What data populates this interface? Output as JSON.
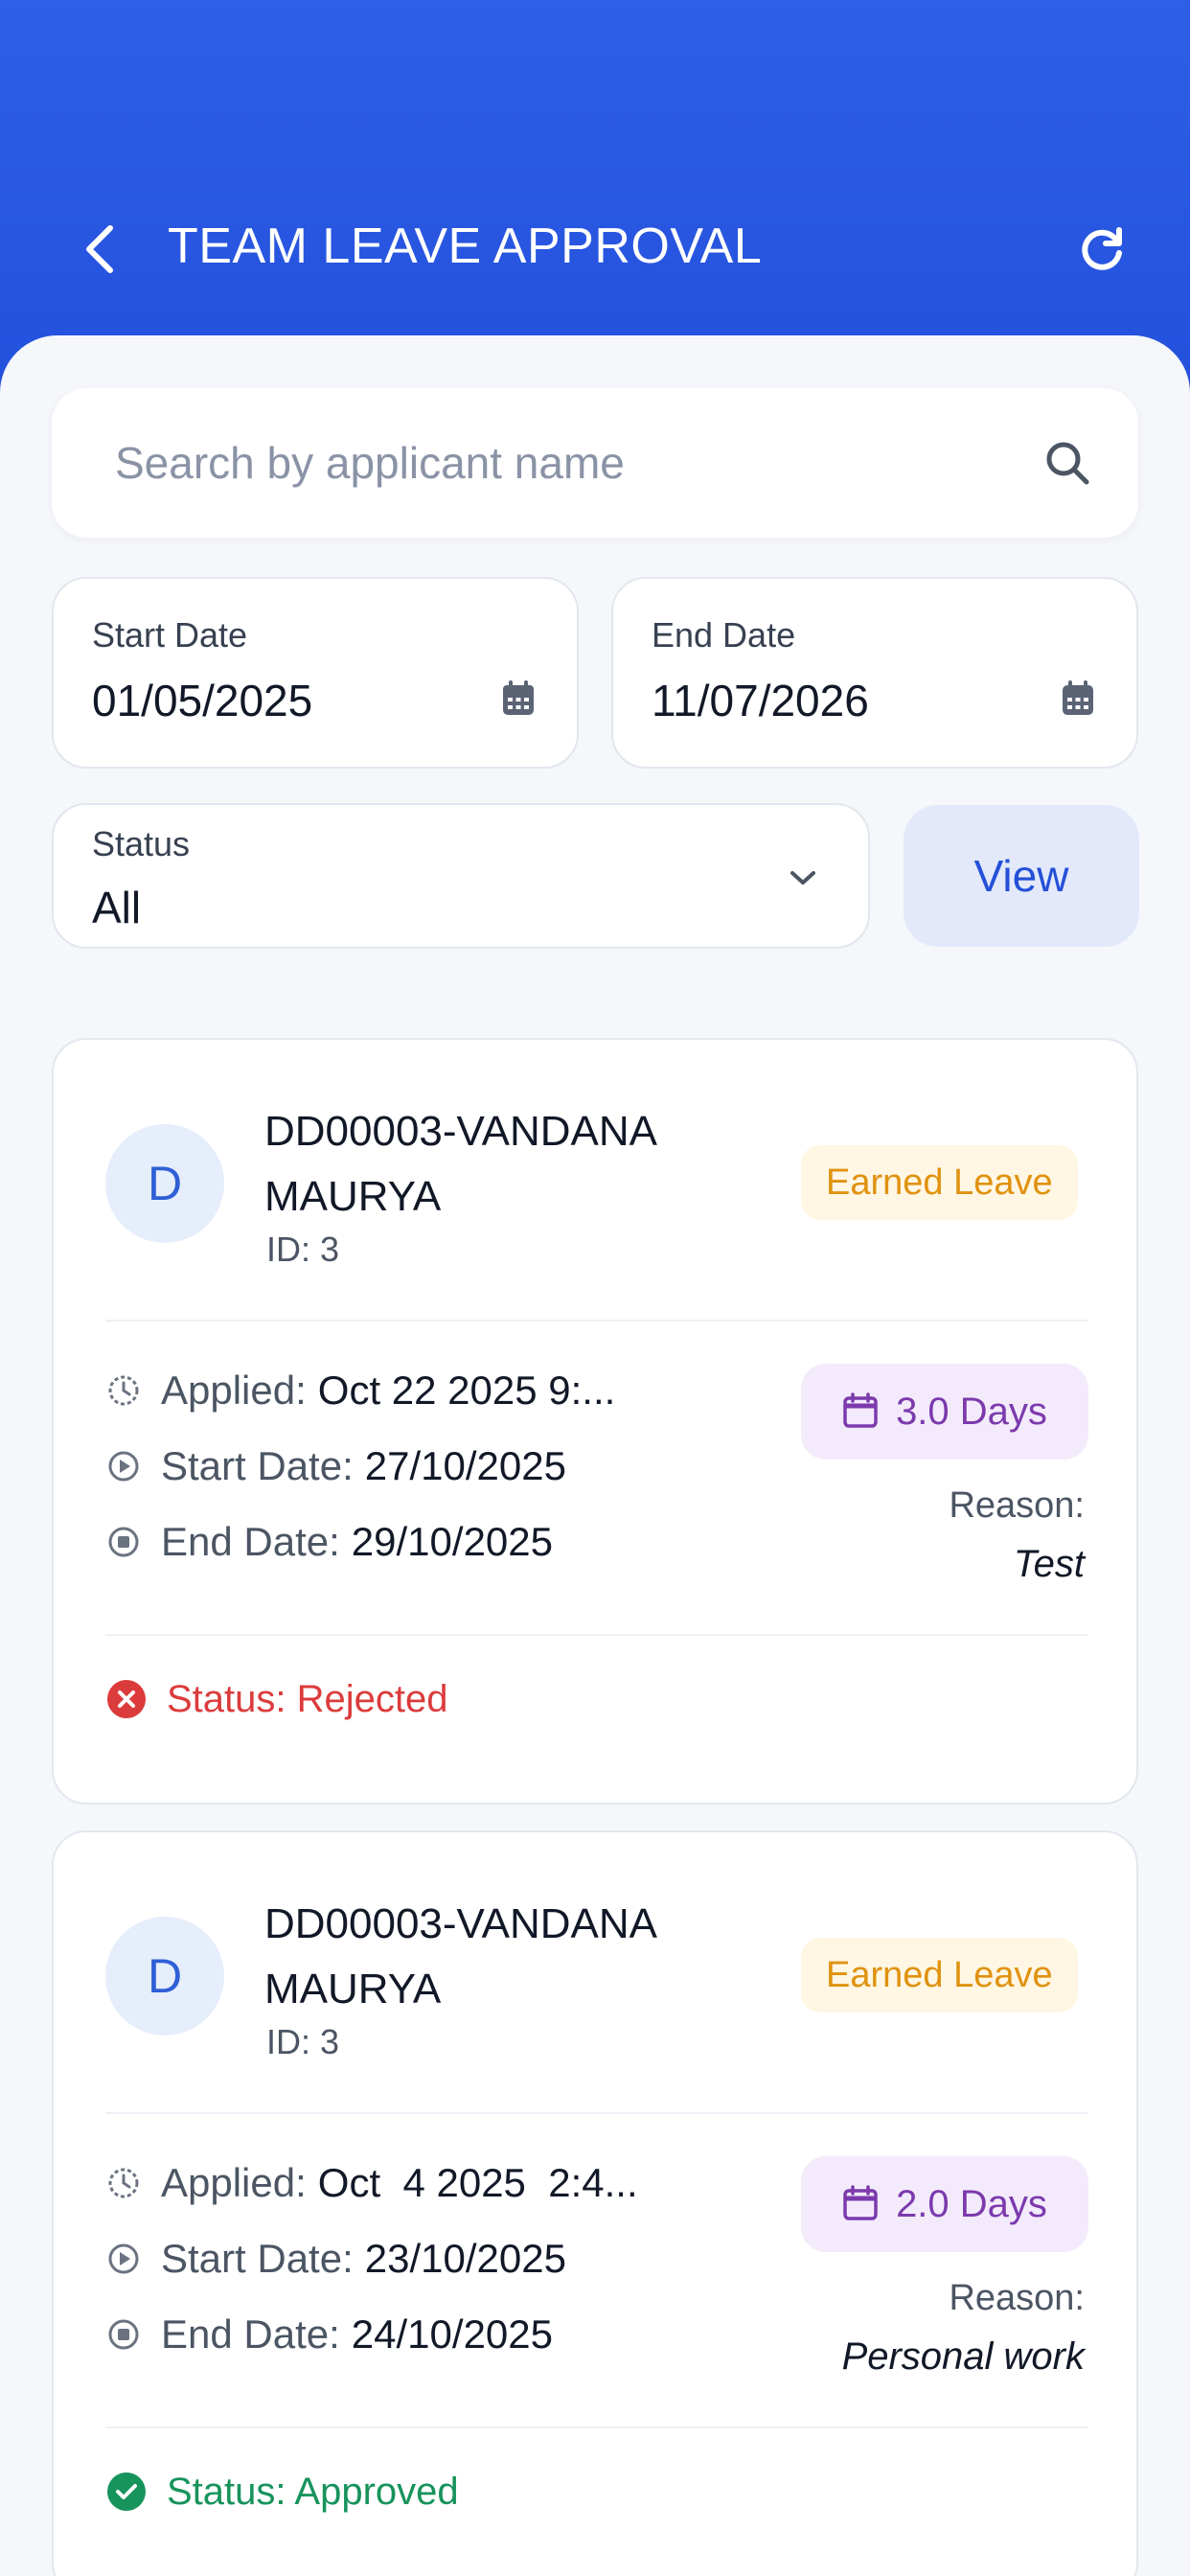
{
  "header": {
    "title": "TEAM LEAVE APPROVAL",
    "back_icon": "chevron-left-icon",
    "refresh_icon": "refresh-icon",
    "background_color": "#2f5fe6"
  },
  "search": {
    "placeholder": "Search by applicant name",
    "value": "",
    "icon": "search-icon"
  },
  "filters": {
    "start_date": {
      "label": "Start Date",
      "value": "01/05/2025"
    },
    "end_date": {
      "label": "End Date",
      "value": "11/07/2026"
    },
    "status": {
      "label": "Status",
      "selected": "All"
    },
    "view_label": "View"
  },
  "requests": [
    {
      "avatar_letter": "D",
      "name": "DD00003-VANDANA MAURYA",
      "id_text": "ID: 3",
      "leave_type": "Earned Leave",
      "applied_label": "Applied:",
      "applied_value": "Oct 22 2025  9:...",
      "start_label": "Start Date:",
      "start_value": "27/10/2025",
      "end_label": "End Date:",
      "end_value": "29/10/2025",
      "days": "3.0 Days",
      "reason_label": "Reason:",
      "reason_value": "Test",
      "status_text": "Status: Rejected",
      "status_color": "#dc3b3b",
      "status_icon": "x-circle-icon"
    },
    {
      "avatar_letter": "D",
      "name": "DD00003-VANDANA MAURYA",
      "id_text": "ID: 3",
      "leave_type": "Earned Leave",
      "applied_label": "Applied:",
      "applied_value": "Oct  4 2025  2:4...",
      "start_label": "Start Date:",
      "start_value": "23/10/2025",
      "end_label": "End Date:",
      "end_value": "24/10/2025",
      "days": "2.0 Days",
      "reason_label": "Reason:",
      "reason_value": "Personal work",
      "status_text": "Status: Approved",
      "status_color": "#17935c",
      "status_icon": "check-circle-icon"
    }
  ]
}
